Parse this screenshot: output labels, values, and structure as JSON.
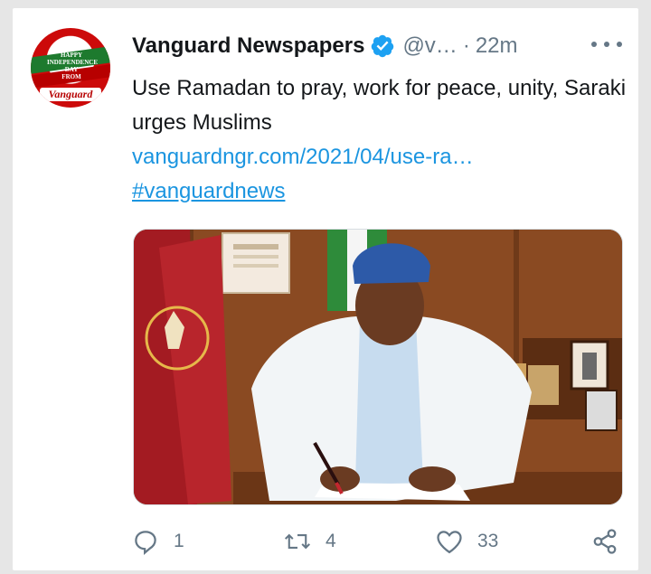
{
  "tweet": {
    "author": {
      "name": "Vanguard Newspapers",
      "handle": "@v…",
      "verified": true,
      "avatar": {
        "lines": [
          "HAPPY",
          "INDEPENDENCE",
          "DAY",
          "FROM"
        ],
        "brand": "Vanguard"
      }
    },
    "separator": "·",
    "time": "22m",
    "text": "Use Ramadan to pray, work for peace, unity, Saraki urges Muslims",
    "link": "vanguardngr.com/2021/04/use-ra…",
    "hashtag": "#vanguardnews",
    "media": {
      "alt": "Man in white agbada signing a document at a desk beside flags"
    },
    "actions": {
      "reply": {
        "icon": "reply-icon",
        "count": "1"
      },
      "retweet": {
        "icon": "retweet-icon",
        "count": "4"
      },
      "like": {
        "icon": "heart-icon",
        "count": "33"
      },
      "share": {
        "icon": "share-icon"
      }
    }
  },
  "colors": {
    "text": "#14171a",
    "muted": "#657786",
    "link": "#1b95e0",
    "verified": "#1da1f2"
  }
}
